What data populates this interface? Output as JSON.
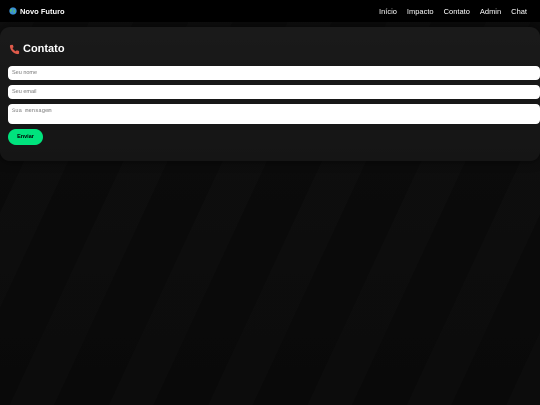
{
  "navbar": {
    "brand_icon": "globe-icon",
    "brand_label": "Novo Futuro",
    "links": [
      {
        "label": "Início"
      },
      {
        "label": "Impacto"
      },
      {
        "label": "Contato"
      },
      {
        "label": "Admin"
      },
      {
        "label": "Chat"
      }
    ]
  },
  "contact": {
    "title_icon": "phone-icon",
    "title": "Contato",
    "name_placeholder": "Seu nome",
    "email_placeholder": "Seu email",
    "message_placeholder": "Sua mensagem",
    "send_label": "Enviar"
  },
  "colors": {
    "accent": "#00e37d",
    "background": "#0a0a0a",
    "navbar": "#000000",
    "card": "#181818"
  }
}
